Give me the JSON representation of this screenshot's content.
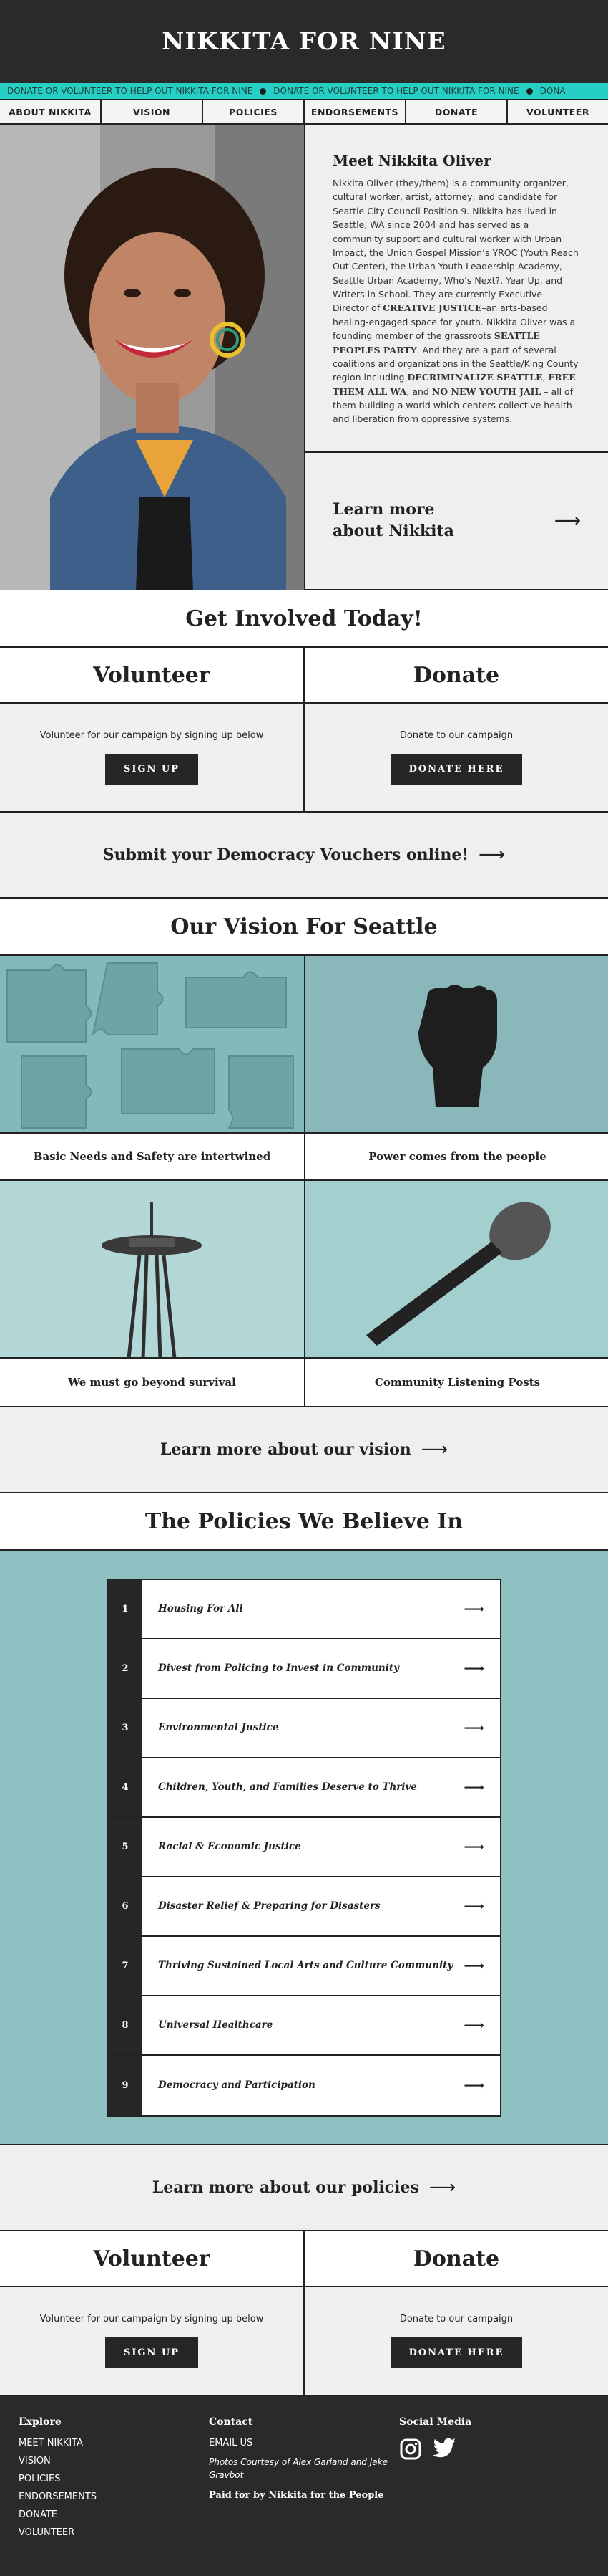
{
  "header": {
    "title": "NIKKITA FOR NINE"
  },
  "ticker": {
    "text": "DONATE OR VOLUNTEER TO HELP OUT NIKKITA FOR NINE",
    "text_partial": "DONA"
  },
  "nav": {
    "items": [
      "ABOUT NIKKITA",
      "VISION",
      "POLICIES",
      "ENDORSEMENTS",
      "DONATE",
      "VOLUNTEER"
    ]
  },
  "meet": {
    "title": "Meet Nikkita Oliver",
    "bio_1": "Nikkita Oliver (they/them) is a community organizer, cultural worker, artist, attorney, and candidate for Seattle City Council Position 9. Nikkita has lived in Seattle, WA since 2004 and has served as a community support and cultural worker with Urban Impact, the Union Gospel Mission’s YROC (Youth Reach Out Center), the Urban Youth Leadership Academy, Seattle Urban Academy, Who’s Next?, Year Up, and Writers in School. They are currently Executive Director of ",
    "bold_1": "CREATIVE JUSTICE",
    "bio_2": "–an arts-based healing-engaged space for youth. Nikkita Oliver was a founding member of the grassroots ",
    "bold_2": "SEATTLE PEOPLES PARTY",
    "bio_3": ". And they are a part of several coalitions and organizations in the Seattle/King County region including ",
    "bold_3": "DECRIMINALIZE SEATTLE",
    "bio_4": ", ",
    "bold_4": "FREE THEM ALL WA",
    "bio_5": ", and ",
    "bold_5": "NO NEW YOUTH JAIL",
    "bio_6": " – all of them building a world which centers collective health and liberation from oppressive systems.",
    "learn_more": "Learn more about Nikkita"
  },
  "involved": {
    "title": "Get Involved Today!"
  },
  "cta": {
    "volunteer_title": "Volunteer",
    "volunteer_text": "Volunteer for our campaign by signing up below",
    "volunteer_button": "SIGN UP",
    "donate_title": "Donate",
    "donate_text": "Donate to our campaign",
    "donate_button": "DONATE HERE"
  },
  "vouchers": {
    "text": "Submit your Democracy Vouchers online!"
  },
  "vision": {
    "title": "Our Vision For Seattle",
    "items": [
      "Basic Needs and Safety are intertwined",
      "Power comes from the people",
      "We must go beyond survival",
      "Community Listening Posts"
    ],
    "learn_more": "Learn more about our vision"
  },
  "policies": {
    "title": "The Policies We Believe In",
    "items": [
      {
        "num": "1",
        "label": "Housing For All"
      },
      {
        "num": "2",
        "label": "Divest from Policing to Invest in Community"
      },
      {
        "num": "3",
        "label": "Environmental Justice"
      },
      {
        "num": "4",
        "label": "Children, Youth, and Families Deserve to Thrive"
      },
      {
        "num": "5",
        "label": "Racial & Economic Justice"
      },
      {
        "num": "6",
        "label": "Disaster Relief & Preparing for Disasters"
      },
      {
        "num": "7",
        "label": "Thriving Sustained Local Arts and Culture Community"
      },
      {
        "num": "8",
        "label": "Universal Healthcare"
      },
      {
        "num": "9",
        "label": "Democracy and Participation"
      }
    ],
    "learn_more": "Learn more about our policies"
  },
  "footer": {
    "explore_title": "Explore",
    "explore": [
      "MEET NIKKITA",
      "VISION",
      "POLICIES",
      "ENDORSEMENTS",
      "DONATE",
      "VOLUNTEER"
    ],
    "contact_title": "Contact",
    "email": "EMAIL US",
    "credit": "Photos Courtesy of Alex Garland and Jake Gravbot",
    "paid": "Paid for by Nikkita for the People",
    "social_title": "Social Media"
  },
  "icons": {
    "arrow": "arrow-right-icon",
    "instagram": "instagram-icon",
    "twitter": "twitter-icon"
  }
}
